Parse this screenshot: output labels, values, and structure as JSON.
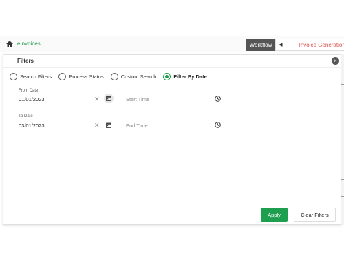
{
  "app": {
    "breadcrumb": "eInvoices",
    "workflow_label": "Workflow",
    "invoice_generation_label": "Invoice Generation"
  },
  "filters": {
    "title": "Filters",
    "options": [
      {
        "label": "Search Filters",
        "selected": false
      },
      {
        "label": "Process Status",
        "selected": false
      },
      {
        "label": "Custom Search",
        "selected": false
      },
      {
        "label": "Filter By Date",
        "selected": true
      }
    ],
    "from_date_label": "From Date",
    "from_date_value": "01/01/2023",
    "start_time_placeholder": "Start Time",
    "to_date_label": "To Date",
    "to_date_value": "03/01/2023",
    "end_time_placeholder": "End Time",
    "apply_label": "Apply",
    "clear_label": "Clear Filters"
  },
  "colors": {
    "accent": "#1e9e4f",
    "breadcrumb": "#1d9a4a",
    "invoice_tab": "#d9534f"
  }
}
